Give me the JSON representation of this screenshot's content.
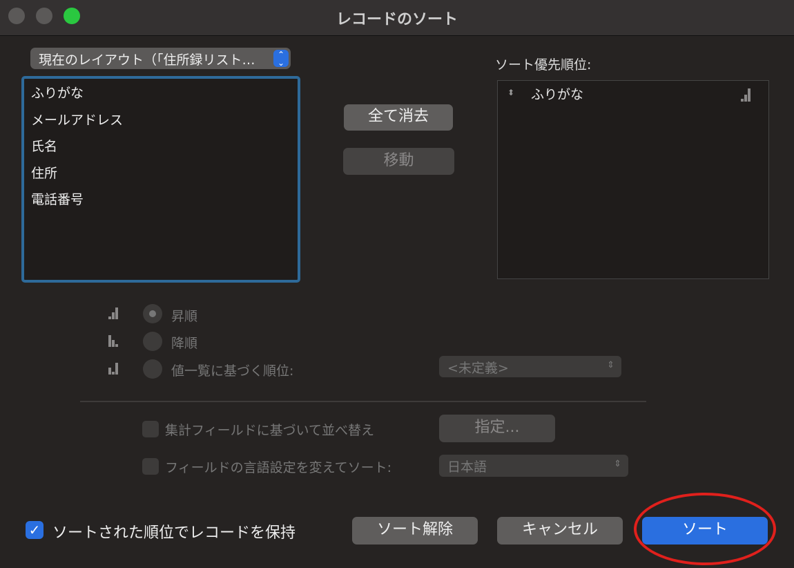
{
  "window": {
    "title": "レコードのソート"
  },
  "layout_popup": {
    "value": "現在のレイアウト（「住所録リスト…"
  },
  "fields": [
    "ふりがな",
    "メールアドレス",
    "氏名",
    "住所",
    "電話番号"
  ],
  "buttons": {
    "clear_all": "全て消去",
    "move": "移動",
    "unsort": "ソート解除",
    "cancel": "キャンセル",
    "sort": "ソート",
    "specify": "指定..."
  },
  "sort_order": {
    "label": "ソート優先順位:",
    "items": [
      {
        "field": "ふりがな",
        "direction": "ascending"
      }
    ]
  },
  "order_options": {
    "ascending": "昇順",
    "descending": "降順",
    "value_list": "値一覧に基づく順位:",
    "value_list_select": "<未定義>",
    "selected": "ascending"
  },
  "summary_checkbox": {
    "label": "集計フィールドに基づいて並べ替え",
    "checked": false
  },
  "language_checkbox": {
    "label": "フィールドの言語設定を変えてソート:",
    "checked": false,
    "select": "日本語"
  },
  "keep_checkbox": {
    "label": "ソートされた順位でレコードを保持",
    "checked": true
  },
  "colors": {
    "accent": "#2a6fe0",
    "highlight_ring": "#e0201c"
  }
}
